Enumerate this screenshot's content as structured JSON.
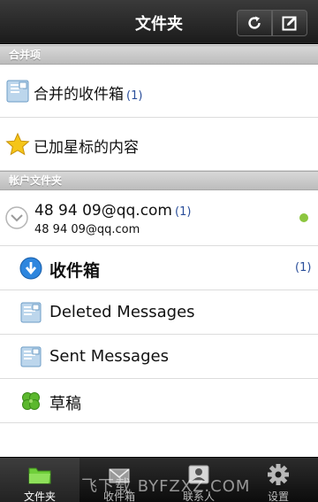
{
  "header": {
    "title": "文件夹"
  },
  "sections": {
    "merged": "合并项",
    "accounts": "帐户文件夹"
  },
  "merged_items": [
    {
      "label": "合并的收件箱",
      "count": "(1)"
    },
    {
      "label": "已加星标的内容",
      "count": ""
    }
  ],
  "account": {
    "name": "48  94  09@qq.com",
    "count": "(1)",
    "email": "48  94  09@qq.com",
    "status_color": "#8cc63f"
  },
  "folders": [
    {
      "label": "收件箱",
      "count": "(1)",
      "icon": "inbox-down-arrow-icon"
    },
    {
      "label": "Deleted Messages",
      "count": "",
      "icon": "folder-icon"
    },
    {
      "label": "Sent Messages",
      "count": "",
      "icon": "folder-icon"
    },
    {
      "label": "草稿",
      "count": "",
      "icon": "clover-icon"
    }
  ],
  "tabs": [
    {
      "label": "文件夹",
      "active": true
    },
    {
      "label": "收件箱"
    },
    {
      "label": "联系人"
    },
    {
      "label": "设置"
    }
  ],
  "watermark": "飞下载 BYFZXZ.COM"
}
